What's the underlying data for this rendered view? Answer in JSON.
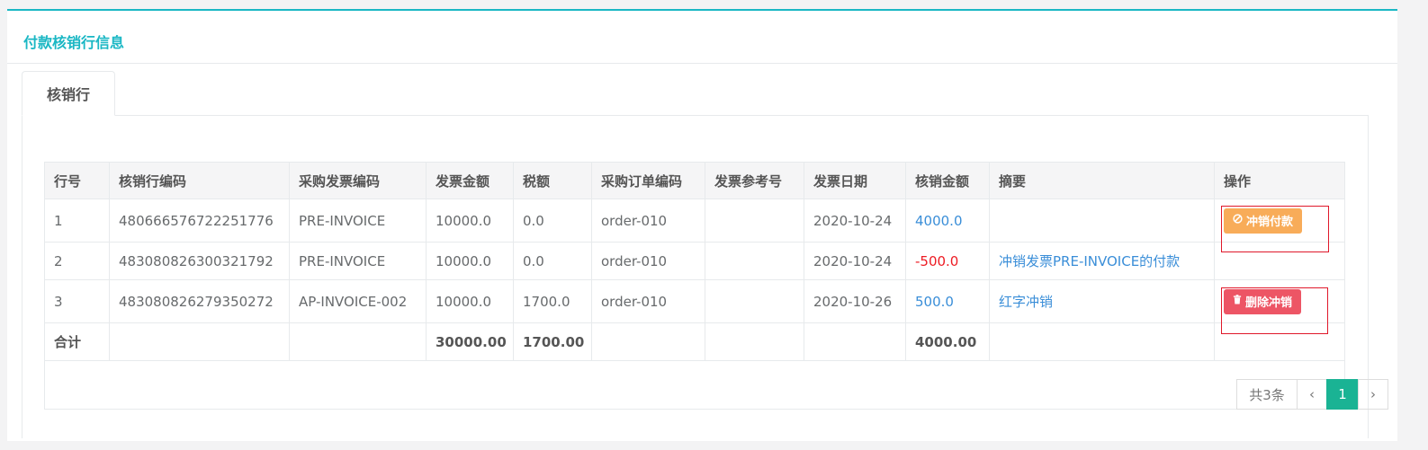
{
  "panel": {
    "title": "付款核销行信息"
  },
  "tabs": [
    {
      "label": "核销行"
    }
  ],
  "table": {
    "headers": [
      "行号",
      "核销行编码",
      "采购发票编码",
      "发票金额",
      "税额",
      "采购订单编码",
      "发票参考号",
      "发票日期",
      "核销金额",
      "摘要",
      "操作"
    ],
    "rows": [
      {
        "no": "1",
        "code": "480666576722251776",
        "invoice": "PRE-INVOICE",
        "amount": "10000.0",
        "tax": "0.0",
        "order": "order-010",
        "ref": "",
        "date": "2020-10-24",
        "writeoff": "4000.0",
        "summary": "",
        "action": "冲销付款"
      },
      {
        "no": "2",
        "code": "483080826300321792",
        "invoice": "PRE-INVOICE",
        "amount": "10000.0",
        "tax": "0.0",
        "order": "order-010",
        "ref": "",
        "date": "2020-10-24",
        "writeoff": "-500.0",
        "summary": "冲销发票PRE-INVOICE的付款",
        "action": ""
      },
      {
        "no": "3",
        "code": "483080826279350272",
        "invoice": "AP-INVOICE-002",
        "amount": "10000.0",
        "tax": "1700.0",
        "order": "order-010",
        "ref": "",
        "date": "2020-10-26",
        "writeoff": "500.0",
        "summary": "红字冲销",
        "action": "删除冲销"
      }
    ],
    "total": {
      "label": "合计",
      "amount": "30000.00",
      "tax": "1700.00",
      "writeoff": "4000.00"
    }
  },
  "pagination": {
    "total": "共3条",
    "current": "1",
    "prev": "‹",
    "next": "›"
  },
  "colors": {
    "accent": "#1ab7c4",
    "link": "#3a8ed8",
    "negative": "#ed1c24",
    "warning_btn": "#f8ac59",
    "danger_btn": "#ed5565",
    "page_active": "#1ab394"
  }
}
